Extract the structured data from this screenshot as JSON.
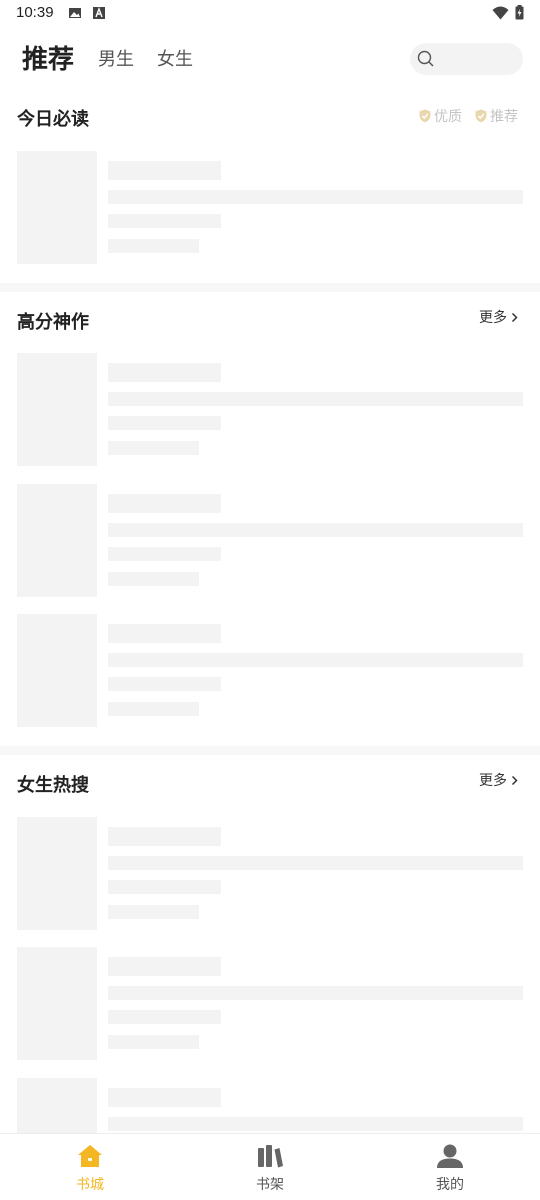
{
  "status_bar": {
    "time": "10:39"
  },
  "header": {
    "tabs": [
      {
        "label": "推荐",
        "active": true
      },
      {
        "label": "男生",
        "active": false
      },
      {
        "label": "女生",
        "active": false
      }
    ],
    "search_icon": "search-icon"
  },
  "sections": [
    {
      "title": "今日必读",
      "tags": [
        "优质",
        "推荐"
      ]
    },
    {
      "title": "高分神作",
      "more_label": "更多"
    },
    {
      "title": "女生热搜",
      "more_label": "更多"
    }
  ],
  "bottom_nav": [
    {
      "label": "书城",
      "icon": "home-icon",
      "active": true
    },
    {
      "label": "书架",
      "icon": "bookshelf-icon",
      "active": false
    },
    {
      "label": "我的",
      "icon": "profile-icon",
      "active": false
    }
  ],
  "colors": {
    "accent": "#f5b623",
    "skeleton": "#f3f3f3",
    "tag_text": "#c4c4c4"
  }
}
